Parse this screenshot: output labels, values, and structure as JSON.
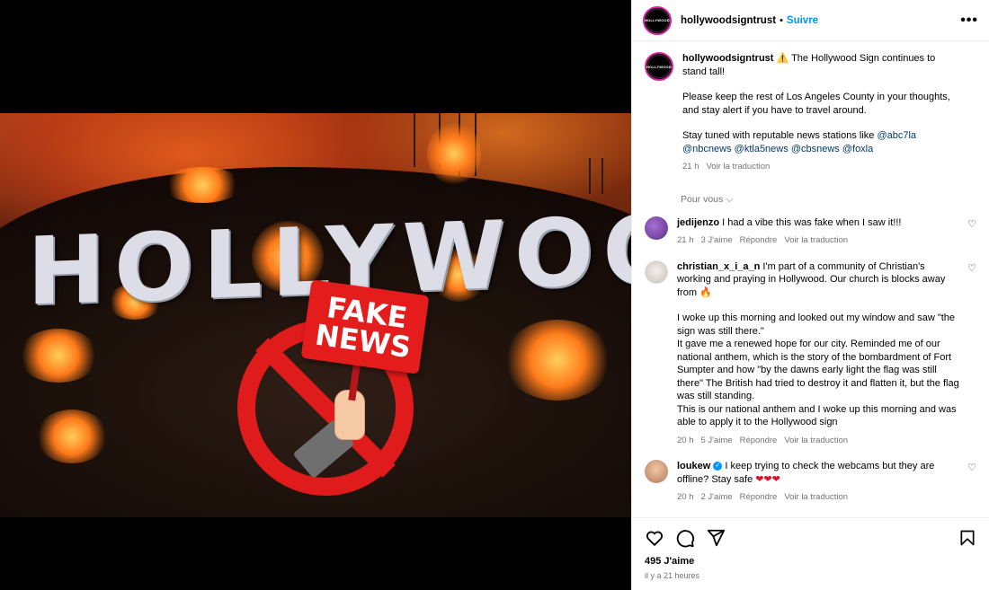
{
  "post": {
    "media": {
      "sign_text": "HOLLYWOOD",
      "placard_line1": "FAKE",
      "placard_line2": "NEWS"
    }
  },
  "header": {
    "avatar_text": "HOLLYWOOD",
    "username": "hollywoodsigntrust",
    "separator": "•",
    "follow_label": "Suivre",
    "more_label": "•••"
  },
  "caption": {
    "username": "hollywoodsigntrust",
    "warning_emoji": "⚠️",
    "line1": "The Hollywood Sign continues to stand tall!",
    "para2": "Please keep the rest of Los Angeles County in your thoughts, and stay alert if you have to travel around.",
    "para3_prefix": "Stay tuned with reputable news stations like",
    "mentions": [
      "@abc7la",
      "@nbcnews",
      "@ktla5news",
      "@cbsnews",
      "@foxla"
    ],
    "time": "21 h",
    "translate": "Voir la traduction"
  },
  "for_you": "Pour vous ⌵",
  "comments": [
    {
      "username": "jedijenzo",
      "text": "I had a vibe this was fake when I saw it!!!",
      "time": "21 h",
      "likes": "3 J'aime",
      "reply": "Répondre",
      "translate": "Voir la traduction"
    },
    {
      "username": "christian_x_i_a_n",
      "text_p1": "I'm part of a community of Christian's working and praying in Hollywood. Our church is blocks away from 🔥",
      "text_p2": "I woke up this morning and looked out my window and saw \"the sign was still there.\"",
      "text_p3": "It gave me a renewed hope for our city. Reminded me of our national anthem, which is the story of the bombardment of Fort Sumpter and how \"by the dawns early light the flag was still there\" The British had tried to destroy it and flatten it, but the flag was still standing.",
      "text_p4": "This is our national anthem and I woke up this morning and was able to apply it to the Hollywood sign",
      "time": "20 h",
      "likes": "5 J'aime",
      "reply": "Répondre",
      "translate": "Voir la traduction"
    },
    {
      "username": "loukew",
      "verified": "✓",
      "text": "I keep trying to check the webcams but they are offline? Stay safe",
      "hearts": "❤❤❤",
      "time": "20 h",
      "likes": "2 J'aime",
      "reply": "Répondre",
      "translate": "Voir la traduction"
    }
  ],
  "footer": {
    "likes": "495 J'aime",
    "posted": "il y a 21 heures"
  },
  "icons": {
    "heart": "heart-icon",
    "comment": "comment-icon",
    "share": "share-icon",
    "save": "bookmark-icon"
  }
}
